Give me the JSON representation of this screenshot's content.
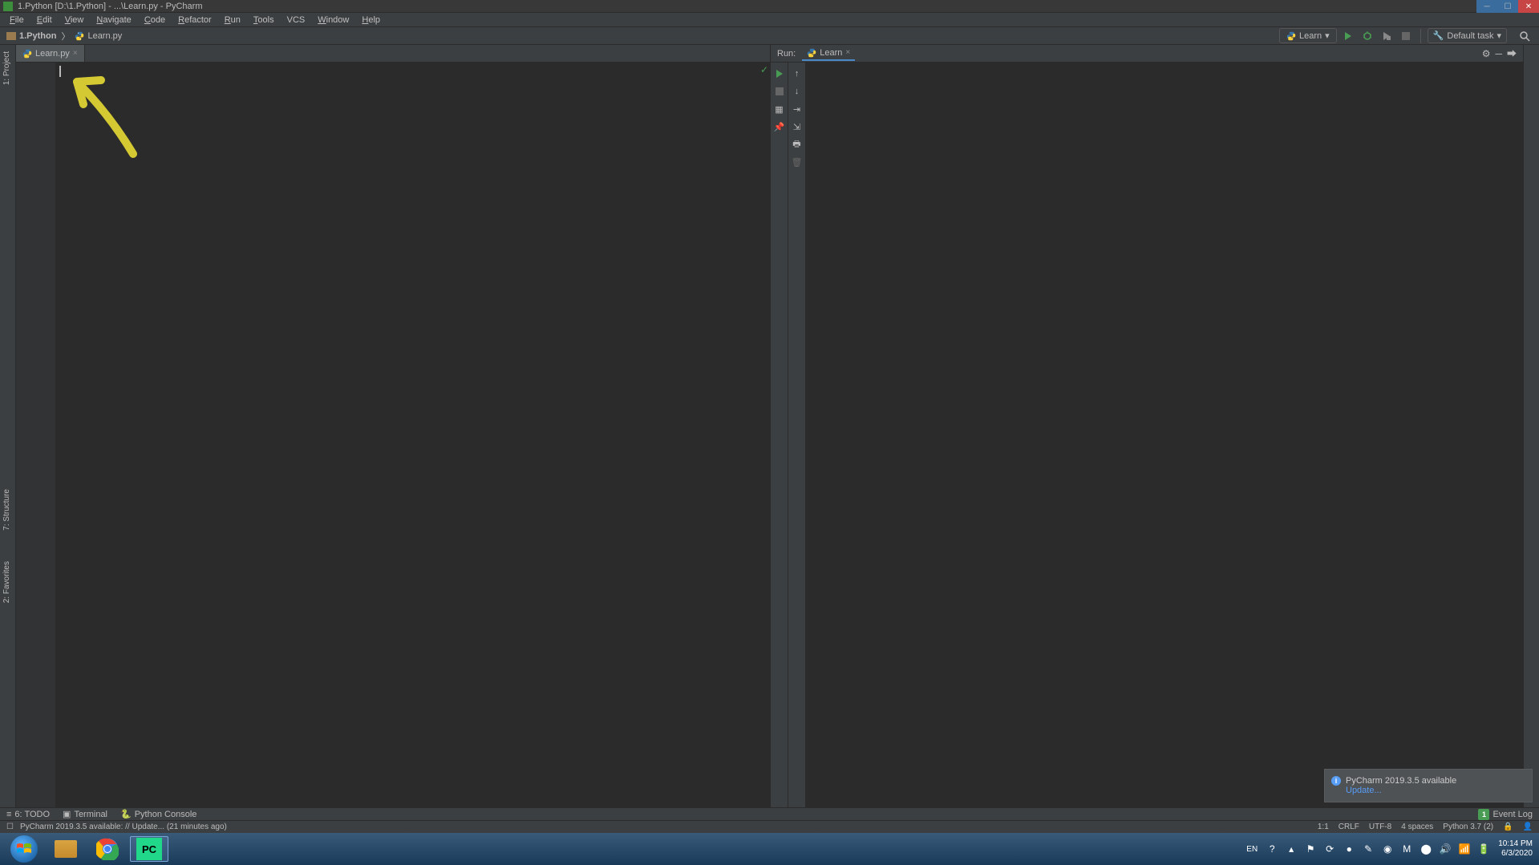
{
  "window": {
    "title": "1.Python [D:\\1.Python] - ...\\Learn.py - PyCharm"
  },
  "menu": [
    "File",
    "Edit",
    "View",
    "Navigate",
    "Code",
    "Refactor",
    "Run",
    "Tools",
    "VCS",
    "Window",
    "Help"
  ],
  "breadcrumb": {
    "project": "1.Python",
    "file": "Learn.py"
  },
  "toolbar": {
    "run_config": "Learn",
    "default_task": "Default task"
  },
  "editor": {
    "tab": "Learn.py"
  },
  "sidebar": {
    "project": "1: Project",
    "structure": "7: Structure",
    "favorites": "2: Favorites"
  },
  "run_panel": {
    "label": "Run:",
    "tab": "Learn"
  },
  "notification": {
    "title": "PyCharm 2019.3.5 available",
    "link": "Update..."
  },
  "bottom_tools": {
    "todo": "6: TODO",
    "terminal": "Terminal",
    "python_console": "Python Console",
    "event_log": "Event Log",
    "event_log_count": "1"
  },
  "status": {
    "message": "PyCharm 2019.3.5 available: // Update... (21 minutes ago)",
    "cursor": "1:1",
    "line_sep": "CRLF",
    "encoding": "UTF-8",
    "indent": "4 spaces",
    "interpreter": "Python 3.7 (2)"
  },
  "taskbar": {
    "lang": "EN",
    "time": "10:14 PM",
    "date": "6/3/2020"
  }
}
